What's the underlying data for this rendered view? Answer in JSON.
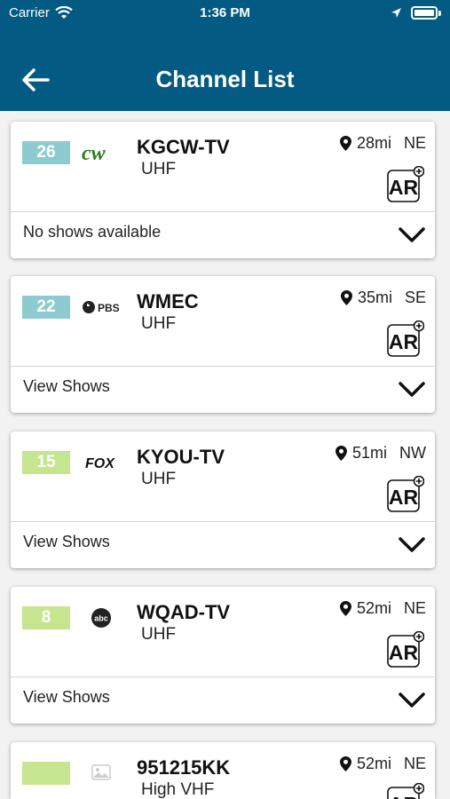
{
  "status_bar": {
    "carrier": "Carrier",
    "time": "1:36 PM"
  },
  "header": {
    "title": "Channel List"
  },
  "channels": [
    {
      "number": "26",
      "badge_color": "#8ecbd0",
      "logo": "cw-logo",
      "callsign": "KGCW-TV",
      "band": "UHF",
      "distance": "28mi",
      "direction": "NE",
      "shows_label": "No shows available"
    },
    {
      "number": "22",
      "badge_color": "#8ecbd0",
      "logo": "pbs-logo",
      "logo_text": "PBS",
      "callsign": "WMEC",
      "band": "UHF",
      "distance": "35mi",
      "direction": "SE",
      "shows_label": "View Shows"
    },
    {
      "number": "15",
      "badge_color": "#c5e68e",
      "logo": "fox-logo",
      "logo_text": "FOX",
      "callsign": "KYOU-TV",
      "band": "UHF",
      "distance": "51mi",
      "direction": "NW",
      "shows_label": "View Shows"
    },
    {
      "number": "8",
      "badge_color": "#c5e68e",
      "logo": "abc-logo",
      "logo_text": "abc",
      "callsign": "WQAD-TV",
      "band": "UHF",
      "distance": "52mi",
      "direction": "NE",
      "shows_label": "View Shows"
    },
    {
      "number": "",
      "badge_color": "#c5e68e",
      "logo": "image-placeholder-icon",
      "callsign": "951215KK",
      "band": "High VHF",
      "distance": "52mi",
      "direction": "NE",
      "shows_label": ""
    }
  ],
  "ar_button_label": "AR"
}
